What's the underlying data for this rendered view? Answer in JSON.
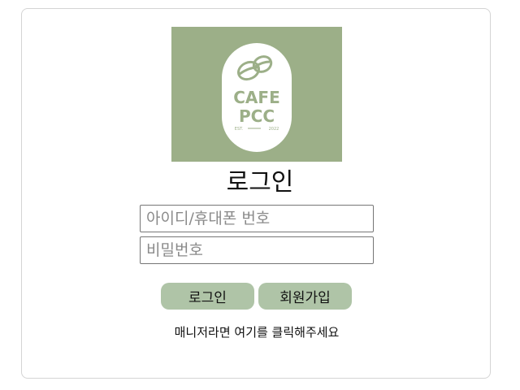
{
  "logo": {
    "brand_line1": "CAFE",
    "brand_line2": "PCC",
    "est_left": "EST.",
    "est_year": "2022",
    "background_color": "#9caf88",
    "icon": "coffee-bean-icon"
  },
  "login": {
    "title": "로그인",
    "id_placeholder": "아이디/휴대폰 번호",
    "password_placeholder": "비밀번호",
    "login_button": "로그인",
    "signup_button": "회원가입",
    "manager_link": "매니저라면 여기를 클릭해주세요"
  },
  "colors": {
    "button_bg": "#afc4a7",
    "logo_bg": "#9caf88",
    "logo_text": "#9caf88"
  }
}
